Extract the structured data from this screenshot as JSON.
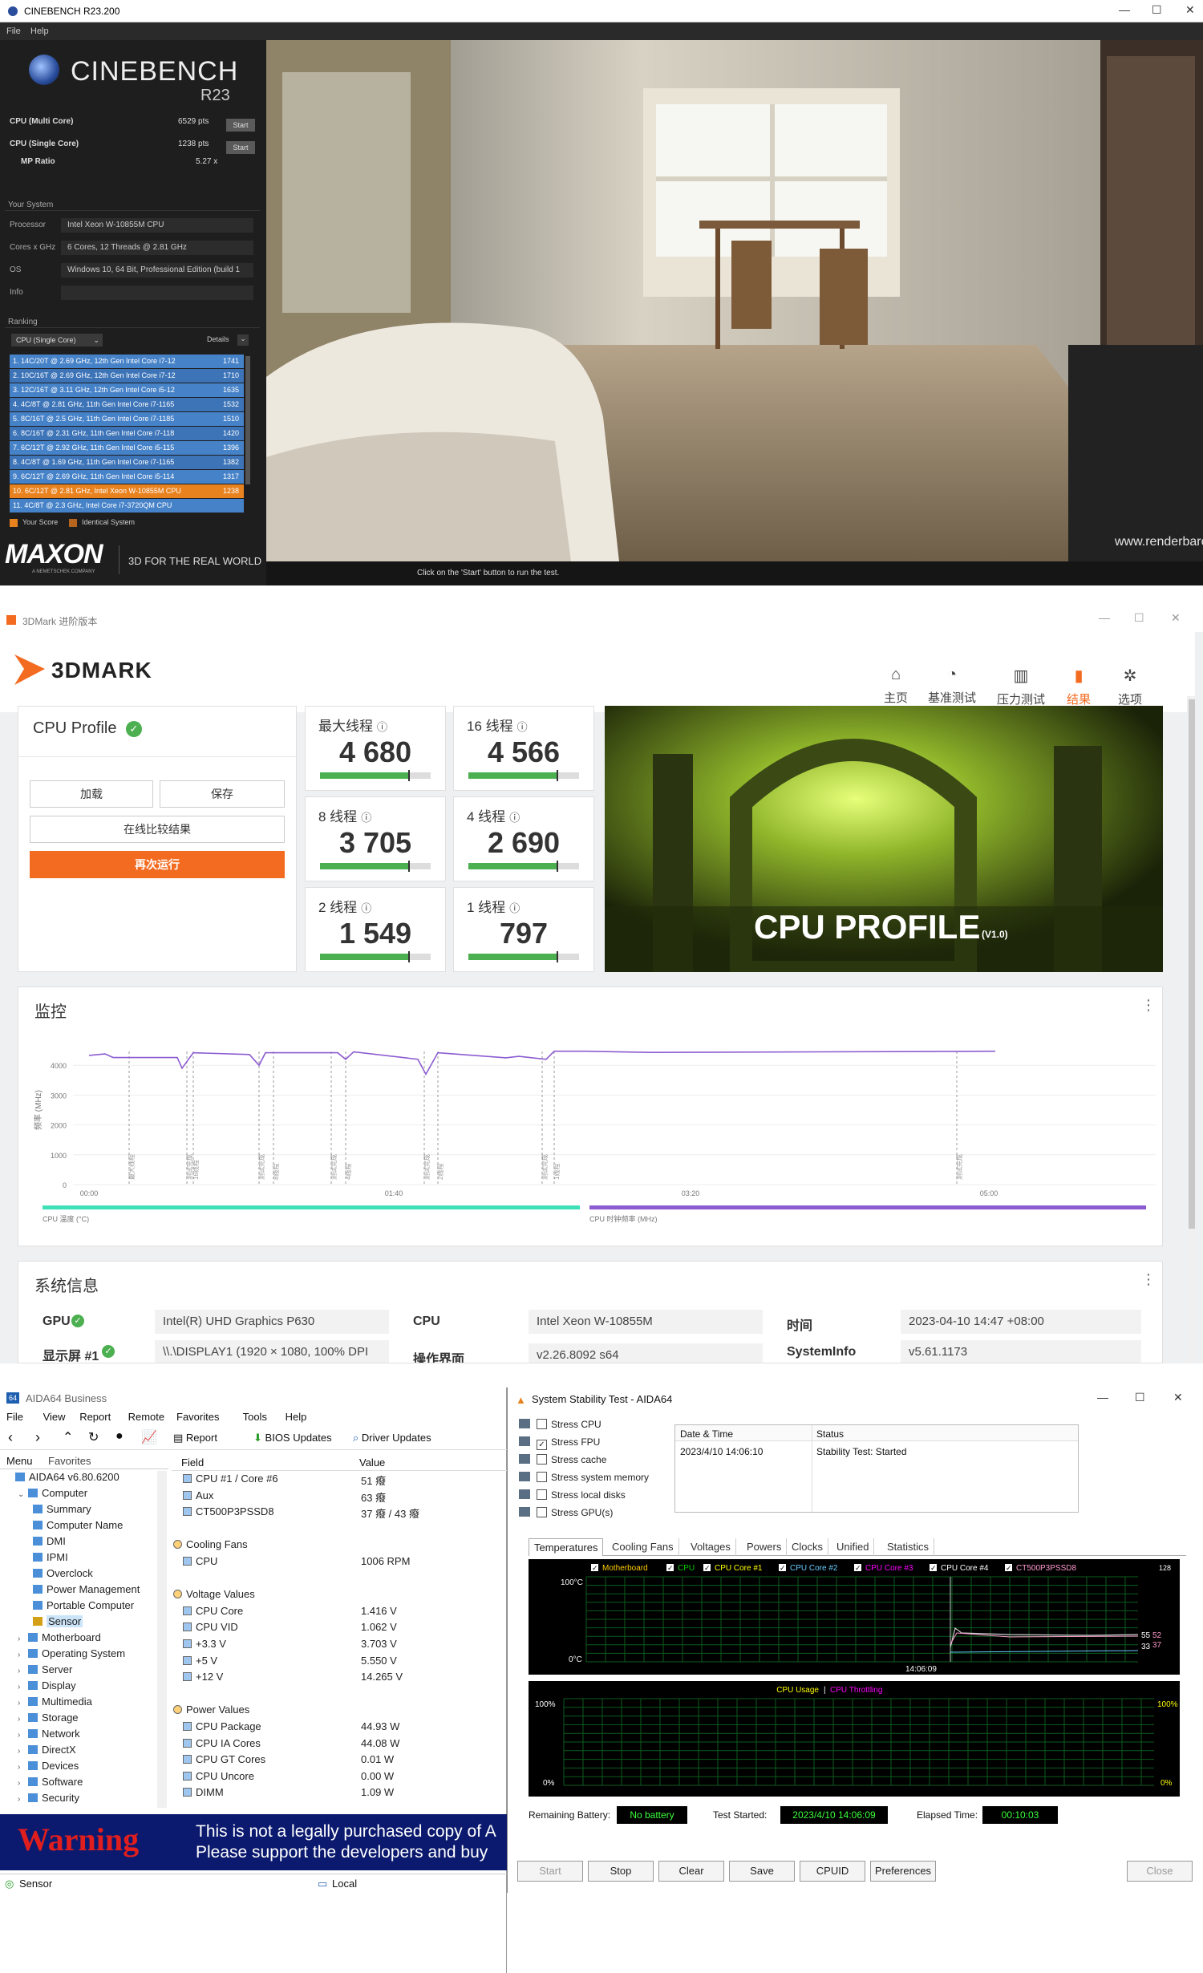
{
  "cinebench": {
    "window_title": "CINEBENCH R23.200",
    "menu": [
      "File",
      "Help"
    ],
    "logo_title": "CINEBENCH",
    "logo_sub": "R23",
    "multi_label": "CPU (Multi Core)",
    "multi_score": "6529 pts",
    "single_label": "CPU (Single Core)",
    "single_score": "1238 pts",
    "start_label": "Start",
    "mp_label": "MP Ratio",
    "mp_value": "5.27 x",
    "your_system": "Your System",
    "processor_label": "Processor",
    "processor": "Intel Xeon W-10855M CPU",
    "cores_label": "Cores x GHz",
    "cores": "6 Cores, 12 Threads @ 2.81 GHz",
    "os_label": "OS",
    "os": "Windows 10, 64 Bit, Professional Edition (build 1",
    "info_label": "Info",
    "ranking": "Ranking",
    "ranking_select": "CPU (Single Core)",
    "details": "Details",
    "rank_items": [
      {
        "text": "1. 14C/20T @ 2.69 GHz, 12th Gen Intel Core i7-12",
        "score": "1741"
      },
      {
        "text": "2. 10C/16T @ 2.69 GHz, 12th Gen Intel Core i7-12",
        "score": "1710"
      },
      {
        "text": "3. 12C/16T @ 3.11 GHz, 12th Gen Intel Core i5-12",
        "score": "1635"
      },
      {
        "text": "4. 4C/8T @ 2.81 GHz, 11th Gen Intel Core i7-1165",
        "score": "1532"
      },
      {
        "text": "5. 8C/16T @ 2.5 GHz, 11th Gen Intel Core i7-1185",
        "score": "1510"
      },
      {
        "text": "6. 8C/16T @ 2.31 GHz, 11th Gen Intel Core i7-118",
        "score": "1420"
      },
      {
        "text": "7. 6C/12T @ 2.92 GHz, 11th Gen Intel Core i5-115",
        "score": "1396"
      },
      {
        "text": "8. 4C/8T @ 1.69 GHz, 11th Gen Intel Core i7-1165",
        "score": "1382"
      },
      {
        "text": "9. 6C/12T @ 2.69 GHz, 11th Gen Intel Core i5-114",
        "score": "1317"
      },
      {
        "text": "10. 6C/12T @ 2.81 GHz, Intel Xeon W-10855M CPU",
        "score": "1238"
      },
      {
        "text": "11. 4C/8T @ 2.3 GHz, Intel Core i7-3720QM CPU",
        "score": ""
      }
    ],
    "your_score": "Your Score",
    "identical_system": "Identical System",
    "maxon": "MAXON",
    "maxon_sub": "A NEMETSCHEK COMPANY",
    "tagline": "3D FOR THE REAL WORLD",
    "watermark": "www.renderbaron.de",
    "hint": "Click on the 'Start' button to run the test."
  },
  "threedmark": {
    "window_title": "3DMark 进阶版本",
    "logo": "3DMARK",
    "nav": [
      {
        "icon": "home-icon",
        "glyph": "⌂",
        "label": "主页"
      },
      {
        "icon": "gauge-icon",
        "glyph": "◔",
        "label": "基准测试"
      },
      {
        "icon": "stress-icon",
        "glyph": "▥",
        "label": "压力测试"
      },
      {
        "icon": "results-icon",
        "glyph": "▮",
        "label": "结果"
      },
      {
        "icon": "gear-icon",
        "glyph": "✲",
        "label": "选项"
      }
    ],
    "profile_title": "CPU Profile",
    "load_btn": "加载",
    "save_btn": "保存",
    "compare_btn": "在线比较结果",
    "rerun_btn": "再次运行",
    "scores": [
      {
        "label": "最大线程",
        "value": "4 680",
        "fill": 0.8
      },
      {
        "label": "16 线程",
        "value": "4 566",
        "fill": 0.8
      },
      {
        "label": "8 线程",
        "value": "3 705",
        "fill": 0.8
      },
      {
        "label": "4 线程",
        "value": "2 690",
        "fill": 0.8
      },
      {
        "label": "2 线程",
        "value": "1 549",
        "fill": 0.8
      },
      {
        "label": "1 线程",
        "value": "797",
        "fill": 0.8
      }
    ],
    "banner_title": "CPU PROFILE",
    "banner_version": "(V1.0)",
    "monitor_title": "监控",
    "chart_ylabel": "频率 (MHz)",
    "chart_yticks": [
      "4000",
      "3000",
      "2000",
      "1000",
      "0"
    ],
    "chart_xticks": [
      "00:00",
      "01:40",
      "03:20",
      "05:00"
    ],
    "legend_temp": "CPU 温度 (°C)",
    "legend_clock": "CPU 时钟频率 (MHz)",
    "markers": [
      "最大线程",
      "测试完成",
      "16线程",
      "测试完成",
      "8线程",
      "测试完成",
      "4线程",
      "测试完成",
      "2线程",
      "测试完成",
      "1线程",
      "测试完成"
    ],
    "sysinfo_title": "系统信息",
    "gpu_label": "GPU",
    "gpu_value": "Intel(R) UHD Graphics P630",
    "cpu_label": "CPU",
    "cpu_value": "Intel Xeon W-10855M",
    "time_label": "时间",
    "time_value": "2023-04-10 14:47 +08:00",
    "display_label": "显示屏 #1",
    "display_value": "\\\\.\\DISPLAY1 (1920 × 1080, 100% DPI",
    "os_label": "操作界面",
    "os_value": "v2.26.8092 s64",
    "sysinfo_label": "SystemInfo",
    "sysinfo_value": "v5.61.1173"
  },
  "aida": {
    "window_title": "AIDA64 Business",
    "menu": [
      "File",
      "View",
      "Report",
      "Remote",
      "Favorites",
      "Tools",
      "Help"
    ],
    "toolbar": {
      "report": "Report",
      "bios": "BIOS Updates",
      "driver": "Driver Updates"
    },
    "tabs": [
      "Menu",
      "Favorites"
    ],
    "tree": [
      {
        "label": "AIDA64 v6.80.6200",
        "indent": 0
      },
      {
        "label": "Computer",
        "indent": 1
      },
      {
        "label": "Summary",
        "indent": 2
      },
      {
        "label": "Computer Name",
        "indent": 2
      },
      {
        "label": "DMI",
        "indent": 2
      },
      {
        "label": "IPMI",
        "indent": 2
      },
      {
        "label": "Overclock",
        "indent": 2
      },
      {
        "label": "Power Management",
        "indent": 2
      },
      {
        "label": "Portable Computer",
        "indent": 2
      },
      {
        "label": "Sensor",
        "indent": 2
      },
      {
        "label": "Motherboard",
        "indent": 1
      },
      {
        "label": "Operating System",
        "indent": 1
      },
      {
        "label": "Server",
        "indent": 1
      },
      {
        "label": "Display",
        "indent": 1
      },
      {
        "label": "Multimedia",
        "indent": 1
      },
      {
        "label": "Storage",
        "indent": 1
      },
      {
        "label": "Network",
        "indent": 1
      },
      {
        "label": "DirectX",
        "indent": 1
      },
      {
        "label": "Devices",
        "indent": 1
      },
      {
        "label": "Software",
        "indent": 1
      },
      {
        "label": "Security",
        "indent": 1
      }
    ],
    "col_field": "Field",
    "col_value": "Value",
    "rows": [
      {
        "f": "CPU #1 / Core #6",
        "v": "51 癈",
        "h": false
      },
      {
        "f": "Aux",
        "v": "63 癈",
        "h": false
      },
      {
        "f": "CT500P3PSSD8",
        "v": "37 癈 / 43 癈",
        "h": false
      },
      {
        "f": "",
        "v": "",
        "h": false
      },
      {
        "f": "Cooling Fans",
        "v": "",
        "h": true
      },
      {
        "f": "CPU",
        "v": "1006 RPM",
        "h": false
      },
      {
        "f": "",
        "v": "",
        "h": false
      },
      {
        "f": "Voltage Values",
        "v": "",
        "h": true
      },
      {
        "f": "CPU Core",
        "v": "1.416 V",
        "h": false
      },
      {
        "f": "CPU VID",
        "v": "1.062 V",
        "h": false
      },
      {
        "f": "+3.3 V",
        "v": "3.703 V",
        "h": false
      },
      {
        "f": "+5 V",
        "v": "5.550 V",
        "h": false
      },
      {
        "f": "+12 V",
        "v": "14.265 V",
        "h": false
      },
      {
        "f": "",
        "v": "",
        "h": false
      },
      {
        "f": "Power Values",
        "v": "",
        "h": true
      },
      {
        "f": "CPU Package",
        "v": "44.93 W",
        "h": false
      },
      {
        "f": "CPU IA Cores",
        "v": "44.08 W",
        "h": false
      },
      {
        "f": "CPU GT Cores",
        "v": "0.01 W",
        "h": false
      },
      {
        "f": "CPU Uncore",
        "v": "0.00 W",
        "h": false
      },
      {
        "f": "DIMM",
        "v": "1.09 W",
        "h": false
      }
    ],
    "warning_title": "Warning",
    "warning_l1": "This is not a legally purchased copy of A",
    "warning_l2": "Please support the developers and buy",
    "status_left": "Sensor",
    "status_mid": "Local"
  },
  "stability": {
    "window_title": "System Stability Test - AIDA64",
    "stress": [
      {
        "label": "Stress CPU",
        "checked": false
      },
      {
        "label": "Stress FPU",
        "checked": true
      },
      {
        "label": "Stress cache",
        "checked": false
      },
      {
        "label": "Stress system memory",
        "checked": false
      },
      {
        "label": "Stress local disks",
        "checked": false
      },
      {
        "label": "Stress GPU(s)",
        "checked": false
      }
    ],
    "col_date": "Date & Time",
    "col_status": "Status",
    "date_value": "2023/4/10 14:06:10",
    "status_value": "Stability Test: Started",
    "tabs": [
      "Temperatures",
      "Cooling Fans",
      "Voltages",
      "Powers",
      "Clocks",
      "Unified",
      "Statistics"
    ],
    "temp_legend": [
      {
        "label": "Motherboard",
        "color": "#ffcc00"
      },
      {
        "label": "CPU",
        "color": "#00cc00"
      },
      {
        "label": "CPU Core #1",
        "color": "#ffff00"
      },
      {
        "label": "CPU Core #2",
        "color": "#66ccff"
      },
      {
        "label": "CPU Core #3",
        "color": "#ff00ff"
      },
      {
        "label": "CPU Core #4",
        "color": "#ffffff"
      },
      {
        "label": "CT500P3PSSD8",
        "color": "#ff99cc"
      }
    ],
    "temp_top": "100°C",
    "temp_bottom": "0°C",
    "temp_right_top": "128",
    "temp_time": "14:06:09",
    "temp_vals": [
      "55",
      "52",
      "33",
      "37"
    ],
    "usage_title": "CPU Usage",
    "throttle_title": "CPU Throttling",
    "usage_top": "100%",
    "usage_bottom": "0%",
    "usage_right_top": "100%",
    "usage_right_bottom": "0%",
    "battery_label": "Remaining Battery:",
    "battery_value": "No battery",
    "started_label": "Test Started:",
    "started_value": "2023/4/10 14:06:09",
    "elapsed_label": "Elapsed Time:",
    "elapsed_value": "00:10:03",
    "buttons": [
      "Start",
      "Stop",
      "Clear",
      "Save",
      "CPUID",
      "Preferences",
      "Close"
    ]
  }
}
